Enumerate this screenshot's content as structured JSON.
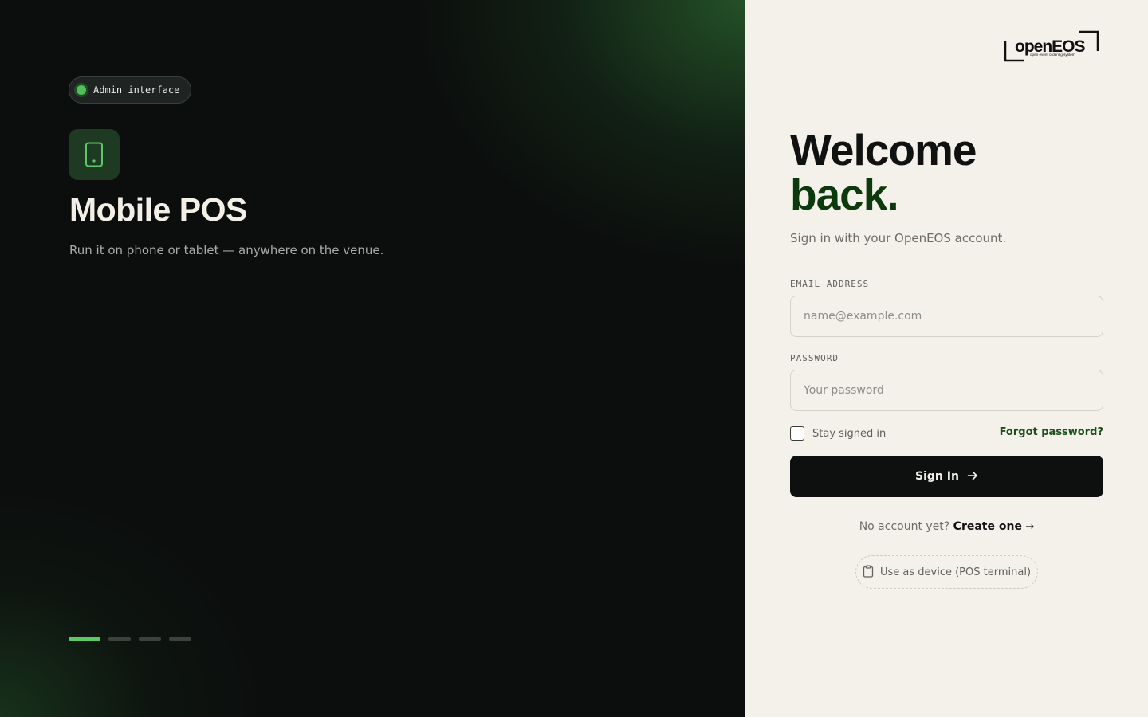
{
  "left_panel": {
    "badge": "Admin interface",
    "feature": {
      "icon": "tablet-icon",
      "title": "Mobile POS",
      "subtitle": "Run it on phone or tablet — anywhere on the venue."
    },
    "carousel": {
      "total": 4,
      "active_index": 0
    }
  },
  "right_panel": {
    "logo": {
      "name": "openEOS",
      "tagline": "open event ordering system"
    },
    "heading_line1": "Welcome",
    "heading_line2": "back.",
    "subtitle": "Sign in with your OpenEOS account.",
    "email": {
      "label": "EMAIL ADDRESS",
      "placeholder": "name@example.com",
      "value": ""
    },
    "password": {
      "label": "PASSWORD",
      "placeholder": "Your password",
      "value": ""
    },
    "remember_label": "Stay signed in",
    "remember_checked": false,
    "forgot_label": "Forgot password?",
    "signin_label": "Sign In",
    "create_prompt": "No account yet?",
    "create_link": "Create one",
    "create_arrow": "→",
    "device_button_label": "Use as device (POS terminal)"
  },
  "colors": {
    "accent_green": "#5cc966",
    "dark_green_text": "#0c3a0c",
    "panel_dark": "#0c0e0d",
    "panel_light": "#f4f1ea"
  }
}
